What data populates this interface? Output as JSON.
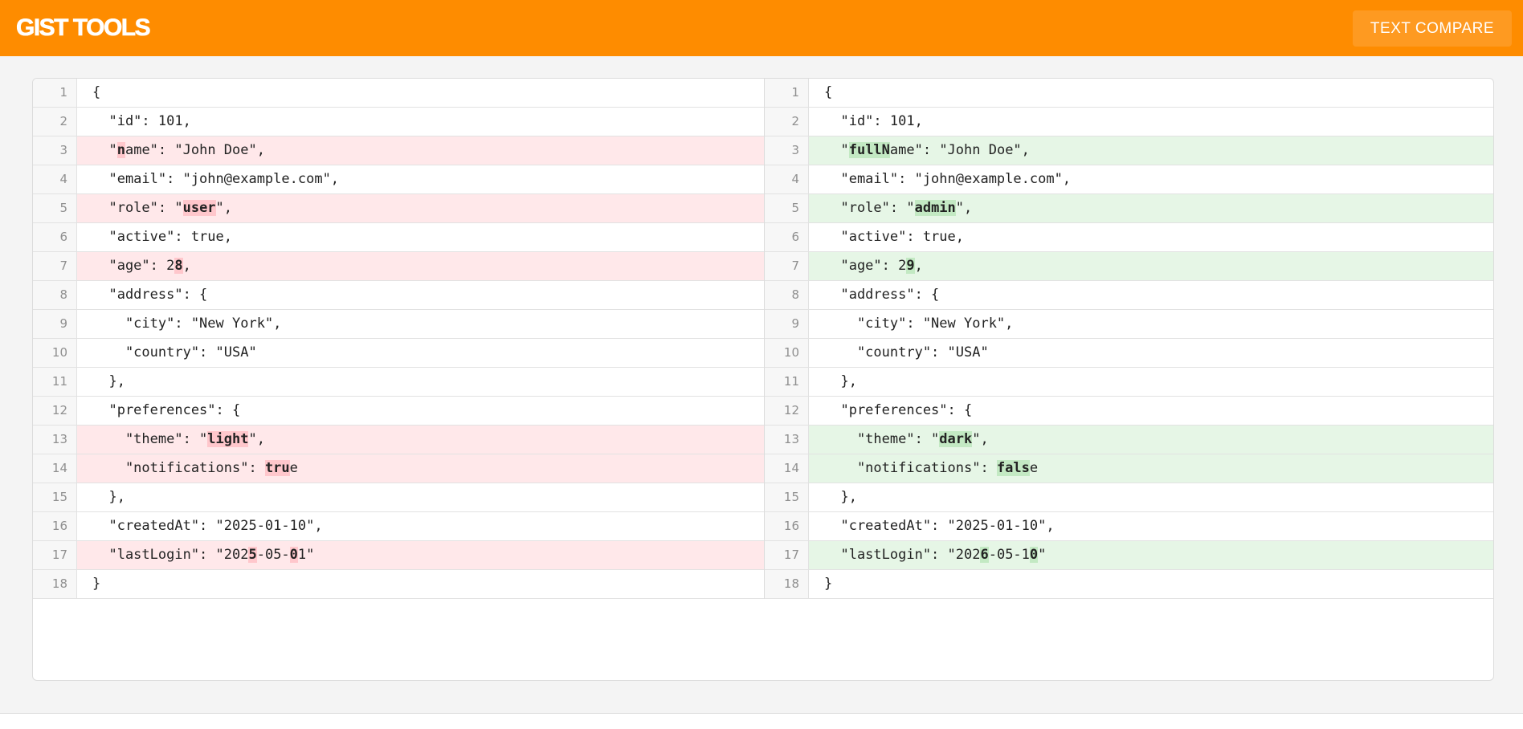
{
  "header": {
    "brand": "GIST TOOLS",
    "nav_button": "TEXT COMPARE",
    "accent_color": "#fe8c00"
  },
  "diff": {
    "colors": {
      "removed_line": "#ffe8ea",
      "removed_word": "#ffc7cc",
      "added_line": "#e6f6e6",
      "added_word": "#c3e9c3"
    },
    "left": [
      {
        "n": "1",
        "s": "",
        "segs": [
          [
            "{",
            false
          ]
        ]
      },
      {
        "n": "2",
        "s": "",
        "segs": [
          [
            "  \"id\": 101,",
            false
          ]
        ]
      },
      {
        "n": "3",
        "s": "del",
        "segs": [
          [
            "  \"",
            false
          ],
          [
            "n",
            true
          ],
          [
            "ame\": \"John Doe\",",
            false
          ]
        ]
      },
      {
        "n": "4",
        "s": "",
        "segs": [
          [
            "  \"email\": \"john@example.com\",",
            false
          ]
        ]
      },
      {
        "n": "5",
        "s": "del",
        "segs": [
          [
            "  \"role\": \"",
            false
          ],
          [
            "user",
            true
          ],
          [
            "\",",
            false
          ]
        ]
      },
      {
        "n": "6",
        "s": "",
        "segs": [
          [
            "  \"active\": true,",
            false
          ]
        ]
      },
      {
        "n": "7",
        "s": "del",
        "segs": [
          [
            "  \"age\": 2",
            false
          ],
          [
            "8",
            true
          ],
          [
            ",",
            false
          ]
        ]
      },
      {
        "n": "8",
        "s": "",
        "segs": [
          [
            "  \"address\": {",
            false
          ]
        ]
      },
      {
        "n": "9",
        "s": "",
        "segs": [
          [
            "    \"city\": \"New York\",",
            false
          ]
        ]
      },
      {
        "n": "10",
        "s": "",
        "segs": [
          [
            "    \"country\": \"USA\"",
            false
          ]
        ]
      },
      {
        "n": "11",
        "s": "",
        "segs": [
          [
            "  },",
            false
          ]
        ]
      },
      {
        "n": "12",
        "s": "",
        "segs": [
          [
            "  \"preferences\": {",
            false
          ]
        ]
      },
      {
        "n": "13",
        "s": "del",
        "segs": [
          [
            "    \"theme\": \"",
            false
          ],
          [
            "light",
            true
          ],
          [
            "\",",
            false
          ]
        ]
      },
      {
        "n": "14",
        "s": "del",
        "segs": [
          [
            "    \"notifications\": ",
            false
          ],
          [
            "tru",
            true
          ],
          [
            "e",
            false
          ]
        ]
      },
      {
        "n": "15",
        "s": "",
        "segs": [
          [
            "  },",
            false
          ]
        ]
      },
      {
        "n": "16",
        "s": "",
        "segs": [
          [
            "  \"createdAt\": \"2025-01-10\",",
            false
          ]
        ]
      },
      {
        "n": "17",
        "s": "del",
        "segs": [
          [
            "  \"lastLogin\": \"202",
            false
          ],
          [
            "5",
            true
          ],
          [
            "-05-",
            false
          ],
          [
            "0",
            true
          ],
          [
            "1\"",
            false
          ]
        ]
      },
      {
        "n": "18",
        "s": "",
        "segs": [
          [
            "}",
            false
          ]
        ]
      }
    ],
    "right": [
      {
        "n": "1",
        "s": "",
        "segs": [
          [
            "{",
            false
          ]
        ]
      },
      {
        "n": "2",
        "s": "",
        "segs": [
          [
            "  \"id\": 101,",
            false
          ]
        ]
      },
      {
        "n": "3",
        "s": "add",
        "segs": [
          [
            "  \"",
            false
          ],
          [
            "fullN",
            true
          ],
          [
            "ame\": \"John Doe\",",
            false
          ]
        ]
      },
      {
        "n": "4",
        "s": "",
        "segs": [
          [
            "  \"email\": \"john@example.com\",",
            false
          ]
        ]
      },
      {
        "n": "5",
        "s": "add",
        "segs": [
          [
            "  \"role\": \"",
            false
          ],
          [
            "admin",
            true
          ],
          [
            "\",",
            false
          ]
        ]
      },
      {
        "n": "6",
        "s": "",
        "segs": [
          [
            "  \"active\": true,",
            false
          ]
        ]
      },
      {
        "n": "7",
        "s": "add",
        "segs": [
          [
            "  \"age\": 2",
            false
          ],
          [
            "9",
            true
          ],
          [
            ",",
            false
          ]
        ]
      },
      {
        "n": "8",
        "s": "",
        "segs": [
          [
            "  \"address\": {",
            false
          ]
        ]
      },
      {
        "n": "9",
        "s": "",
        "segs": [
          [
            "    \"city\": \"New York\",",
            false
          ]
        ]
      },
      {
        "n": "10",
        "s": "",
        "segs": [
          [
            "    \"country\": \"USA\"",
            false
          ]
        ]
      },
      {
        "n": "11",
        "s": "",
        "segs": [
          [
            "  },",
            false
          ]
        ]
      },
      {
        "n": "12",
        "s": "",
        "segs": [
          [
            "  \"preferences\": {",
            false
          ]
        ]
      },
      {
        "n": "13",
        "s": "add",
        "segs": [
          [
            "    \"theme\": \"",
            false
          ],
          [
            "dark",
            true
          ],
          [
            "\",",
            false
          ]
        ]
      },
      {
        "n": "14",
        "s": "add",
        "segs": [
          [
            "    \"notifications\": ",
            false
          ],
          [
            "fals",
            true
          ],
          [
            "e",
            false
          ]
        ]
      },
      {
        "n": "15",
        "s": "",
        "segs": [
          [
            "  },",
            false
          ]
        ]
      },
      {
        "n": "16",
        "s": "",
        "segs": [
          [
            "  \"createdAt\": \"2025-01-10\",",
            false
          ]
        ]
      },
      {
        "n": "17",
        "s": "add",
        "segs": [
          [
            "  \"lastLogin\": \"202",
            false
          ],
          [
            "6",
            true
          ],
          [
            "-05-1",
            false
          ],
          [
            "0",
            true
          ],
          [
            "\"",
            false
          ]
        ]
      },
      {
        "n": "18",
        "s": "",
        "segs": [
          [
            "}",
            false
          ]
        ]
      }
    ]
  }
}
